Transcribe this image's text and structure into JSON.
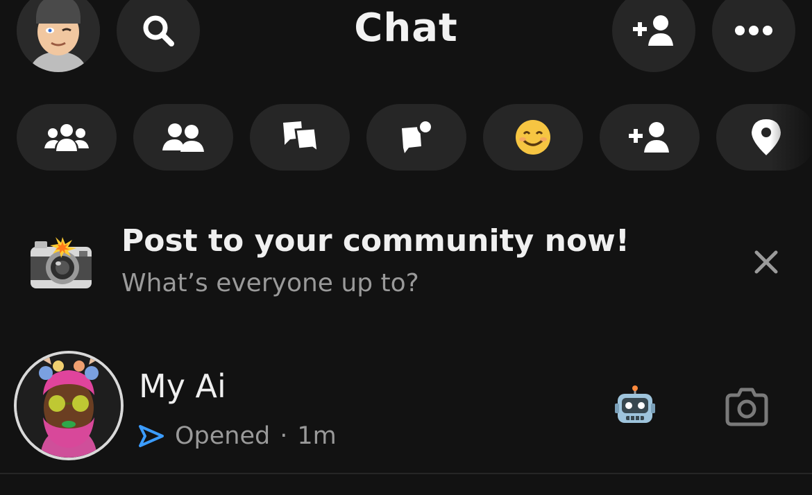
{
  "header": {
    "title": "Chat",
    "avatar_icon": "bitmoji-avatar",
    "search_icon": "search-icon",
    "add_friend_icon": "add-friend-icon",
    "more_icon": "more-icon"
  },
  "filters": [
    {
      "icon": "groups-icon"
    },
    {
      "icon": "friends-icon"
    },
    {
      "icon": "chats-icon"
    },
    {
      "icon": "unread-icon"
    },
    {
      "icon": "smiley-icon"
    },
    {
      "icon": "add-friend-icon"
    },
    {
      "icon": "location-pin-icon"
    }
  ],
  "promo": {
    "title": "Post to your community now!",
    "subtitle": "What’s everyone up to?",
    "icon": "camera-flash-icon"
  },
  "chats": [
    {
      "name": "My Ai",
      "status": "Opened",
      "separator": "·",
      "time": "1m",
      "status_icon": "sent-arrow-icon",
      "badge_icon": "robot-icon"
    }
  ],
  "colors": {
    "background": "#121212",
    "button": "#262626",
    "sent_blue": "#3b9cff",
    "secondary_text": "#9a9a9a"
  }
}
